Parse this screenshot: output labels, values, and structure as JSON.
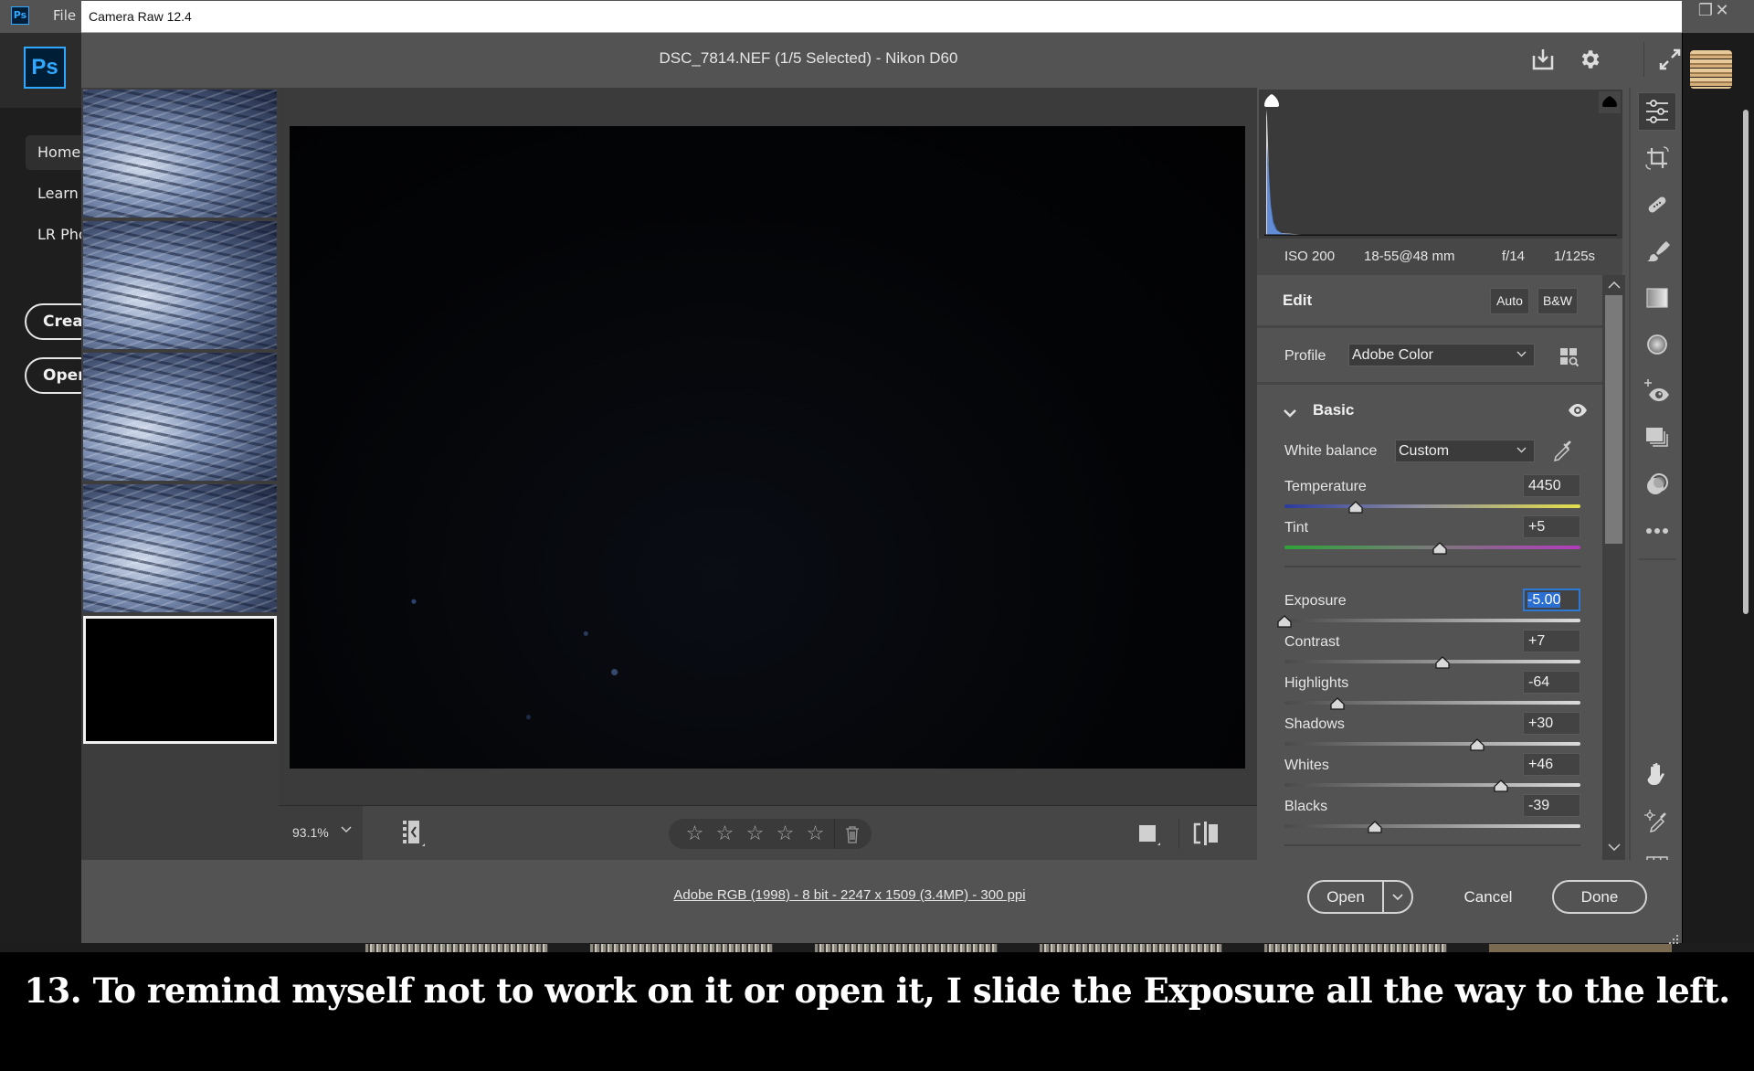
{
  "photoshop": {
    "menu_file": "File",
    "logo_text": "Ps",
    "nav": [
      {
        "label": "Home",
        "active": true
      },
      {
        "label": "Learn",
        "active": false
      },
      {
        "label": "LR Photos",
        "active": false
      }
    ],
    "buttons": {
      "create": "Create new",
      "open": "Open"
    },
    "window_close": "✕",
    "window_restore": "❐"
  },
  "camera_raw": {
    "window_title": "Camera Raw 12.4",
    "header": {
      "file_title": "DSC_7814.NEF (1/5 Selected)  -  Nikon D60",
      "icons": [
        "save-image-icon",
        "settings-gear-icon",
        "full-screen-icon"
      ]
    },
    "filmstrip": {
      "selected_index": 4,
      "thumbnails": [
        {
          "kind": "photo"
        },
        {
          "kind": "photo"
        },
        {
          "kind": "photo"
        },
        {
          "kind": "photo"
        },
        {
          "kind": "dark"
        }
      ]
    },
    "preview_toolbar": {
      "zoom_level": "93.1%",
      "rating_stars": 0,
      "max_stars": 5,
      "star_glyph": "☆"
    },
    "footer": {
      "workflow_link": "Adobe RGB (1998) - 8 bit - 2247 x 1509 (3.4MP) - 300 ppi",
      "open_label": "Open",
      "cancel_label": "Cancel",
      "done_label": "Done"
    },
    "exif": {
      "iso": "ISO 200",
      "lens": "18-55@48 mm",
      "aperture": "f/14",
      "shutter": "1/125s"
    },
    "edit": {
      "title": "Edit",
      "auto_label": "Auto",
      "bw_label": "B&W",
      "profile_label": "Profile",
      "profile_value": "Adobe Color",
      "basic": {
        "title": "Basic",
        "white_balance_label": "White balance",
        "white_balance_value": "Custom",
        "sliders": [
          {
            "name": "temperature",
            "label": "Temperature",
            "value": "4450",
            "position": 0.24,
            "track": "temp"
          },
          {
            "name": "tint",
            "label": "Tint",
            "value": "+5",
            "position": 0.525,
            "track": "tint"
          },
          {
            "name": "exposure",
            "label": "Exposure",
            "value": "-5.00",
            "position": 0.0,
            "track": "gray",
            "focused": true
          },
          {
            "name": "contrast",
            "label": "Contrast",
            "value": "+7",
            "position": 0.535,
            "track": "gray"
          },
          {
            "name": "highlights",
            "label": "Highlights",
            "value": "-64",
            "position": 0.18,
            "track": "gray"
          },
          {
            "name": "shadows",
            "label": "Shadows",
            "value": "+30",
            "position": 0.65,
            "track": "gray"
          },
          {
            "name": "whites",
            "label": "Whites",
            "value": "+46",
            "position": 0.73,
            "track": "gray"
          },
          {
            "name": "blacks",
            "label": "Blacks",
            "value": "-39",
            "position": 0.305,
            "track": "gray"
          }
        ]
      }
    },
    "tools": [
      {
        "name": "edit-sliders-icon",
        "active": true
      },
      {
        "name": "crop-rotate-icon"
      },
      {
        "name": "spot-removal-icon"
      },
      {
        "name": "adjustment-brush-icon"
      },
      {
        "name": "graduated-filter-icon"
      },
      {
        "name": "radial-filter-icon"
      },
      {
        "name": "red-eye-icon"
      },
      {
        "name": "snapshots-icon"
      },
      {
        "name": "presets-icon"
      },
      {
        "name": "more-options-icon"
      },
      {
        "name": "hand-tool-icon"
      },
      {
        "name": "color-sampler-icon"
      },
      {
        "name": "grid-overlay-icon"
      }
    ]
  },
  "caption": {
    "text": "13. To remind myself not to work on it or open it, I slide the Exposure all the way to the left."
  },
  "colors": {
    "accent_blue": "#2c7ad6",
    "ps_blue": "#31a8ff",
    "panel_bg": "#535353"
  }
}
